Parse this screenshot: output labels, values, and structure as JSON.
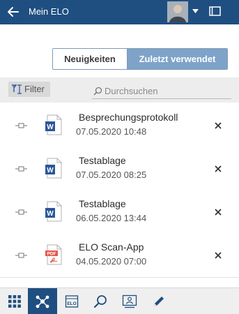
{
  "header": {
    "title": "Mein ELO",
    "back_icon": "arrow-left-icon",
    "avatar": "user-avatar",
    "menu_icon": "chevron-down-icon",
    "panel_icon": "panel-icon"
  },
  "toggle": {
    "news_label": "Neuigkeiten",
    "recent_label": "Zuletzt verwendet",
    "active": "recent"
  },
  "filter": {
    "label": "Filter",
    "icon": "filter-icon"
  },
  "search": {
    "placeholder": "Durchsuchen",
    "icon": "search-icon"
  },
  "items": [
    {
      "name": "Besprechungsprotokoll",
      "date": "07.05.2020 10:48",
      "type": "word"
    },
    {
      "name": "Testablage",
      "date": "07.05.2020 08:25",
      "type": "word"
    },
    {
      "name": "Testablage",
      "date": "06.05.2020 13:44",
      "type": "word"
    },
    {
      "name": "ELO Scan-App",
      "date": "04.05.2020 07:00",
      "type": "pdf"
    }
  ],
  "bottom_nav": [
    {
      "icon": "grid-icon",
      "active": false
    },
    {
      "icon": "network-icon",
      "active": true
    },
    {
      "icon": "elo-archive-icon",
      "active": false
    },
    {
      "icon": "search-icon",
      "active": false
    },
    {
      "icon": "user-card-icon",
      "active": false
    },
    {
      "icon": "pen-icon",
      "active": false
    }
  ],
  "colors": {
    "header_bg": "#1f4f80",
    "active_segment": "#7fa3c8",
    "word_blue": "#2b579a",
    "pdf_red": "#e2574c"
  }
}
